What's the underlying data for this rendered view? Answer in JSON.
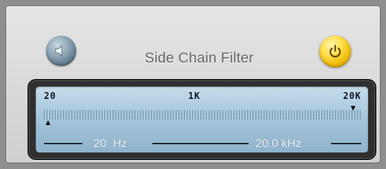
{
  "panel": {
    "title": "Side Chain Filter",
    "accent_power": "#f2c500",
    "accent_speaker": "#7f98a8"
  },
  "buttons": {
    "speaker_icon": "speaker-icon",
    "power_icon": "power-icon"
  },
  "display": {
    "scale_min": "20",
    "scale_mid": "1K",
    "scale_max": "20K",
    "low_freq": "20  Hz",
    "high_freq": "20.0 kHz",
    "low_marker_fraction": 0.0,
    "high_marker_fraction": 1.0,
    "bg_color": "#a9c8de"
  }
}
